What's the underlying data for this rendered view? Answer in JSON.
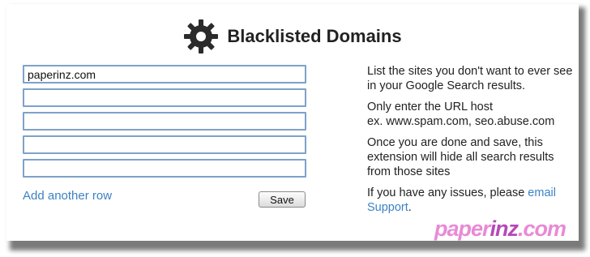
{
  "header": {
    "title": "Blacklisted Domains",
    "icon": "gear-icon",
    "icon_color": "#2b2b2b"
  },
  "domains": {
    "rows": [
      {
        "value": "paperinz.com"
      },
      {
        "value": ""
      },
      {
        "value": ""
      },
      {
        "value": ""
      },
      {
        "value": ""
      }
    ]
  },
  "actions": {
    "add_row_label": "Add another row",
    "save_label": "Save"
  },
  "help": {
    "p1": "List the sites you don't want to ever see in your Google Search results.",
    "p2_line1": "Only enter the URL host",
    "p2_line2": "ex. www.spam.com, seo.abuse.com",
    "p3": "Once you are done and save, this extension will hide all search results from those sites",
    "p4_text": "If you have any issues, please ",
    "p4_link": "email Support",
    "p4_end": "."
  },
  "watermark": {
    "part1": "paper",
    "part2": "inz",
    "part3": ".com"
  },
  "colors": {
    "link": "#3b82c4",
    "input_border": "#7ea2c9",
    "watermark_light": "#e88ad6",
    "watermark_dark": "#b44ab8"
  }
}
